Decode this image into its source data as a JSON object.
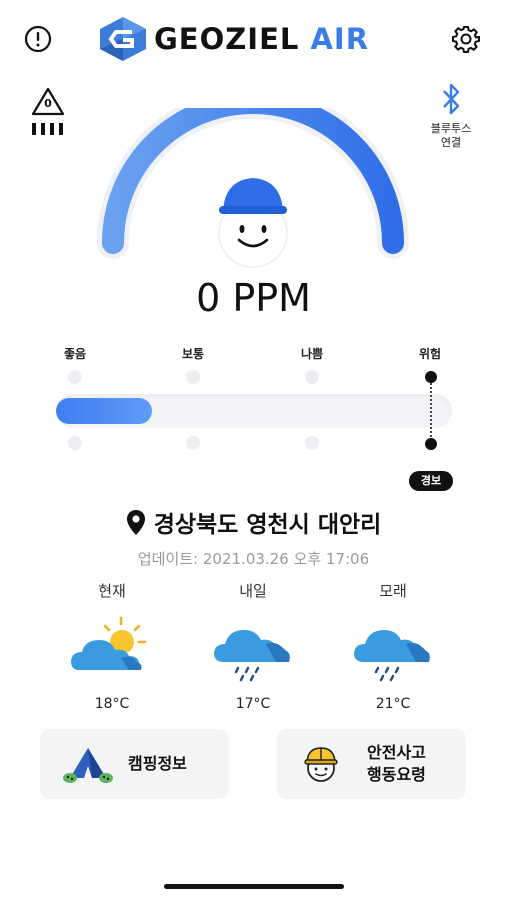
{
  "header": {
    "logo_text_dark": "GEOZIEL",
    "logo_text_blue": "AIR",
    "alert_icon": "exclamation-circle-icon",
    "settings_icon": "gear-icon"
  },
  "device": {
    "warning_count": "0",
    "bluetooth_label": "블루투스\n연결"
  },
  "gauge": {
    "reading": "0 PPM",
    "level_fraction": 1.0
  },
  "levels": {
    "labels": [
      "좋음",
      "보통",
      "나쁨",
      "위험"
    ],
    "alarm_label": "경보"
  },
  "location": {
    "name": "경상북도 영천시 대안리",
    "updated": "업데이트: 2021.03.26 오후 17:06"
  },
  "weather": [
    {
      "day": "현재",
      "temp": "18°C",
      "icon": "partly-sunny-icon"
    },
    {
      "day": "내일",
      "temp": "17°C",
      "icon": "rain-cloud-icon"
    },
    {
      "day": "모래",
      "temp": "21°C",
      "icon": "rain-cloud-icon"
    }
  ],
  "cards": {
    "camping": "캠핑정보",
    "safety": "안전사고\n행동요령"
  },
  "colors": {
    "accent": "#3a7de6",
    "dark": "#111111"
  }
}
